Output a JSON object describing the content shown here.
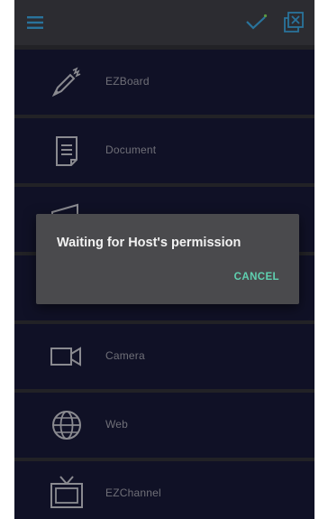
{
  "toolbar": {
    "menu_icon": "hamburger-menu-icon",
    "check_icon": "checkmark-icon",
    "window_close_icon": "close-window-icon",
    "accent_color": "#3aa0d8"
  },
  "menu": {
    "items": [
      {
        "label": "EZBoard",
        "icon": "pen-icon"
      },
      {
        "label": "Document",
        "icon": "document-icon"
      },
      {
        "label": "",
        "icon": "photo-icon"
      },
      {
        "label": "",
        "icon": "video-icon"
      },
      {
        "label": "Camera",
        "icon": "camera-icon"
      },
      {
        "label": "Web",
        "icon": "globe-icon"
      },
      {
        "label": "EZChannel",
        "icon": "tv-icon"
      }
    ]
  },
  "dialog": {
    "message": "Waiting for Host's permission",
    "cancel_label": "CANCEL",
    "cancel_color": "#5fd0b0"
  }
}
